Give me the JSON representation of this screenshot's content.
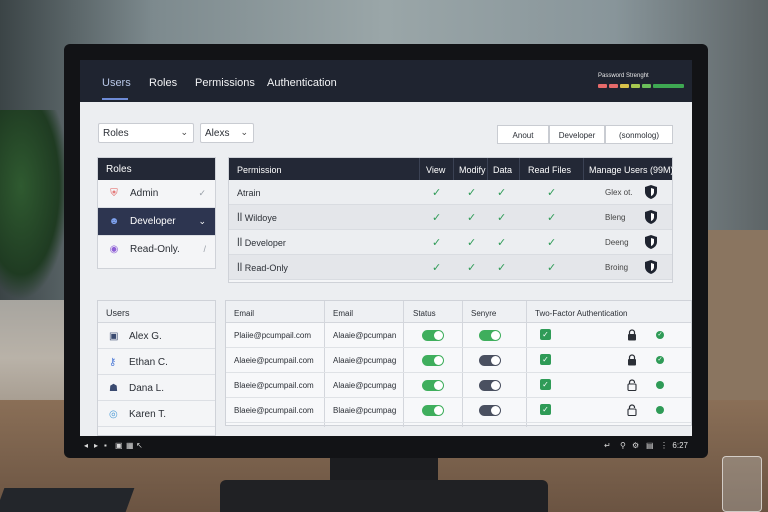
{
  "nav": {
    "tabs": [
      {
        "label": "Users"
      },
      {
        "label": "Roles"
      },
      {
        "label": "Permissions"
      },
      {
        "label": "Authentication"
      }
    ],
    "password_strength_label": "Password Strenght",
    "password_strength_colors": [
      "#e56a6a",
      "#e56a6a",
      "#d9c24a",
      "#a7c84f",
      "#6bbf5a",
      "#3ea852",
      "#3ea852"
    ]
  },
  "filters": {
    "role_select": "Roles",
    "user_select": "Alexs",
    "segments": [
      "Anout",
      "Developer",
      "(sonmolog)"
    ]
  },
  "roles_panel": {
    "title": "Roles",
    "items": [
      {
        "label": "Admin",
        "icon": "shield-icon",
        "icon_color": "#e05656",
        "trail": "✓",
        "selected": false
      },
      {
        "label": "Developer",
        "icon": "robot-icon",
        "icon_color": "#4a78d6",
        "trail": "⌄",
        "selected": true
      },
      {
        "label": "Read-Only.",
        "icon": "circle-icon",
        "icon_color": "#8e5fd6",
        "trail": "/",
        "selected": false
      }
    ]
  },
  "permissions": {
    "headers": [
      "Permission",
      "View",
      "Modify",
      "Data",
      "Read Files",
      "Manage Users (99M)"
    ],
    "rows": [
      {
        "name": "Atrain",
        "checks": [
          true,
          true,
          true,
          true
        ],
        "extra": "Glex ot."
      },
      {
        "name": "Wildoye",
        "prefix": "ꟾꟾ",
        "checks": [
          true,
          true,
          true,
          true
        ],
        "extra": "Bleng"
      },
      {
        "name": "Developer",
        "prefix": "ꟾꟾ",
        "checks": [
          true,
          true,
          true,
          true
        ],
        "extra": "Deeng"
      },
      {
        "name": "Read-Only",
        "prefix": "ꟾꟾ",
        "checks": [
          true,
          true,
          true,
          true
        ],
        "extra": "Broing"
      }
    ]
  },
  "users_panel": {
    "title": "Users",
    "items": [
      {
        "label": "Alex G.",
        "icon": "briefcase-icon"
      },
      {
        "label": "Ethan C.",
        "icon": "key-icon"
      },
      {
        "label": "Dana L.",
        "icon": "person-icon"
      },
      {
        "label": "Karen T.",
        "icon": "circle-user-icon"
      }
    ]
  },
  "email_table": {
    "headers": [
      "Email",
      "Email",
      "Status",
      "Senyre",
      "Two-Factor Authentication"
    ],
    "rows": [
      {
        "email1": "Plaiie@pcumpail.com",
        "email2": "Alaaie@pcumpan",
        "status_on": true,
        "secure_on": true,
        "lock": "locked"
      },
      {
        "email1": "Alaeie@pcumpail.com",
        "email2": "Alaaie@pcumpag",
        "status_on": true,
        "secure_on": false,
        "lock": "locked"
      },
      {
        "email1": "Blaeie@pcumpail.com",
        "email2": "Alaaie@pcumpag",
        "status_on": true,
        "secure_on": false,
        "lock": "unlocked"
      },
      {
        "email1": "Blaeie@pcumpail.com",
        "email2": "Blaaie@pcumpag",
        "status_on": true,
        "secure_on": false,
        "lock": "unlocked"
      }
    ]
  },
  "taskbar": {
    "time": "6:27"
  },
  "colors": {
    "green": "#2f9b57",
    "toggle_on": "#3fae5d",
    "toggle_off": "#4a5060",
    "header_dark": "#232836"
  }
}
